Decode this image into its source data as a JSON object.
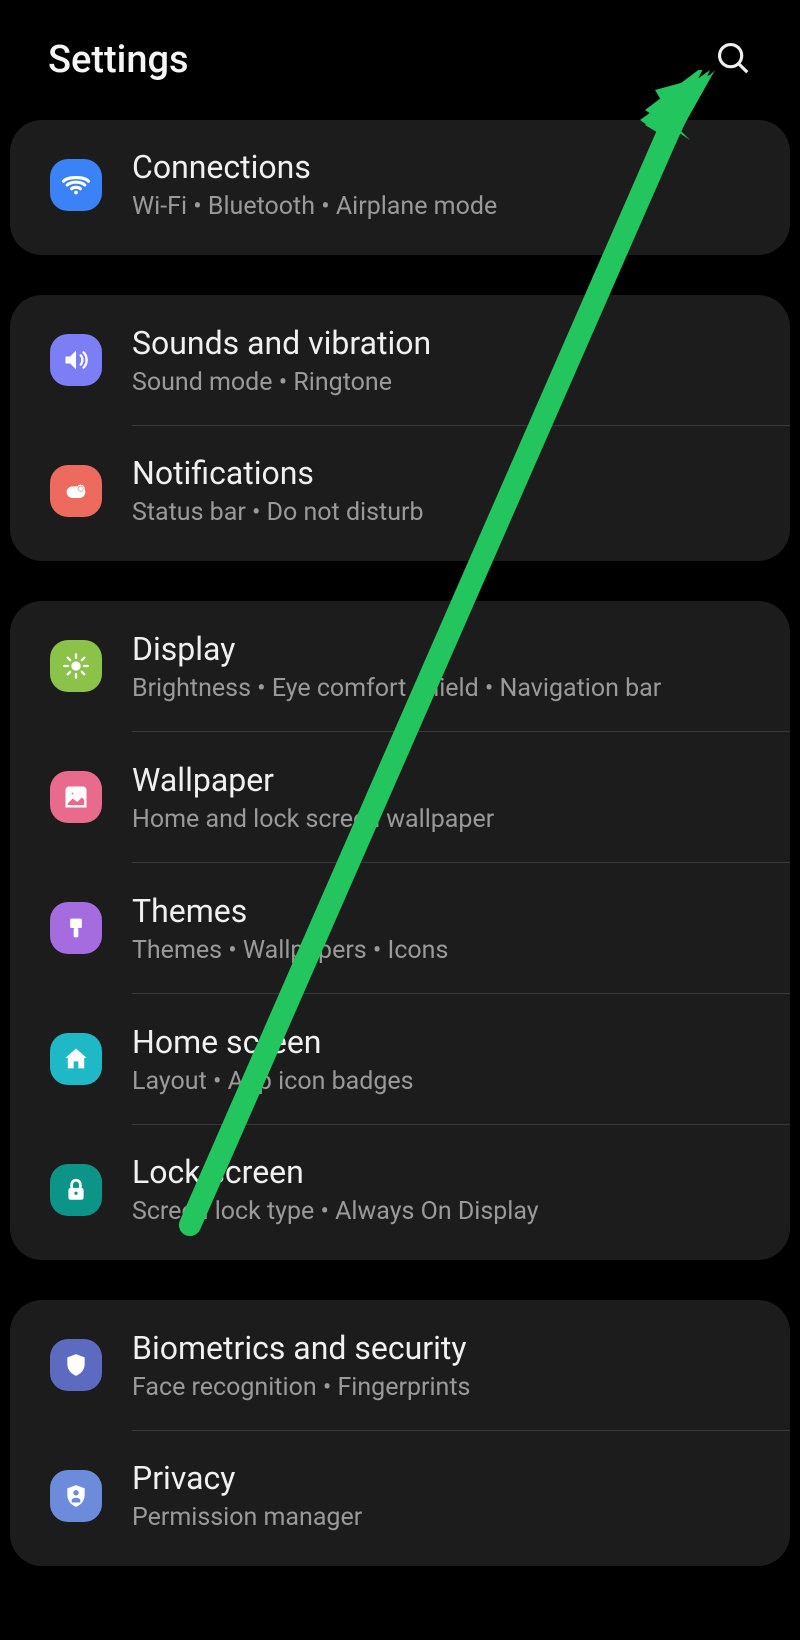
{
  "header": {
    "title": "Settings",
    "search_icon": "search-icon"
  },
  "groups": [
    {
      "items": [
        {
          "icon": "wifi-icon",
          "icon_color": "ic-blue",
          "title": "Connections",
          "subtitle": "Wi-Fi  •  Bluetooth  •  Airplane mode"
        }
      ]
    },
    {
      "items": [
        {
          "icon": "sound-icon",
          "icon_color": "ic-purple",
          "title": "Sounds and vibration",
          "subtitle": "Sound mode  •  Ringtone"
        },
        {
          "icon": "notifications-icon",
          "icon_color": "ic-coral",
          "title": "Notifications",
          "subtitle": "Status bar  •  Do not disturb"
        }
      ]
    },
    {
      "items": [
        {
          "icon": "display-icon",
          "icon_color": "ic-green",
          "title": "Display",
          "subtitle": "Brightness  •  Eye comfort shield  •  Navigation bar"
        },
        {
          "icon": "wallpaper-icon",
          "icon_color": "ic-pink",
          "title": "Wallpaper",
          "subtitle": "Home and lock screen wallpaper"
        },
        {
          "icon": "themes-icon",
          "icon_color": "ic-violet",
          "title": "Themes",
          "subtitle": "Themes  •  Wallpapers  •  Icons"
        },
        {
          "icon": "home-icon",
          "icon_color": "ic-teal",
          "title": "Home screen",
          "subtitle": "Layout  •  App icon badges"
        },
        {
          "icon": "lock-icon",
          "icon_color": "ic-darkteal",
          "title": "Lock screen",
          "subtitle": "Screen lock type  •  Always On Display"
        }
      ]
    },
    {
      "items": [
        {
          "icon": "shield-icon",
          "icon_color": "ic-indigo",
          "title": "Biometrics and security",
          "subtitle": "Face recognition  •  Fingerprints"
        },
        {
          "icon": "privacy-icon",
          "icon_color": "ic-lblue",
          "title": "Privacy",
          "subtitle": "Permission manager"
        }
      ]
    }
  ],
  "annotation": {
    "arrow_color": "#22c55e"
  }
}
